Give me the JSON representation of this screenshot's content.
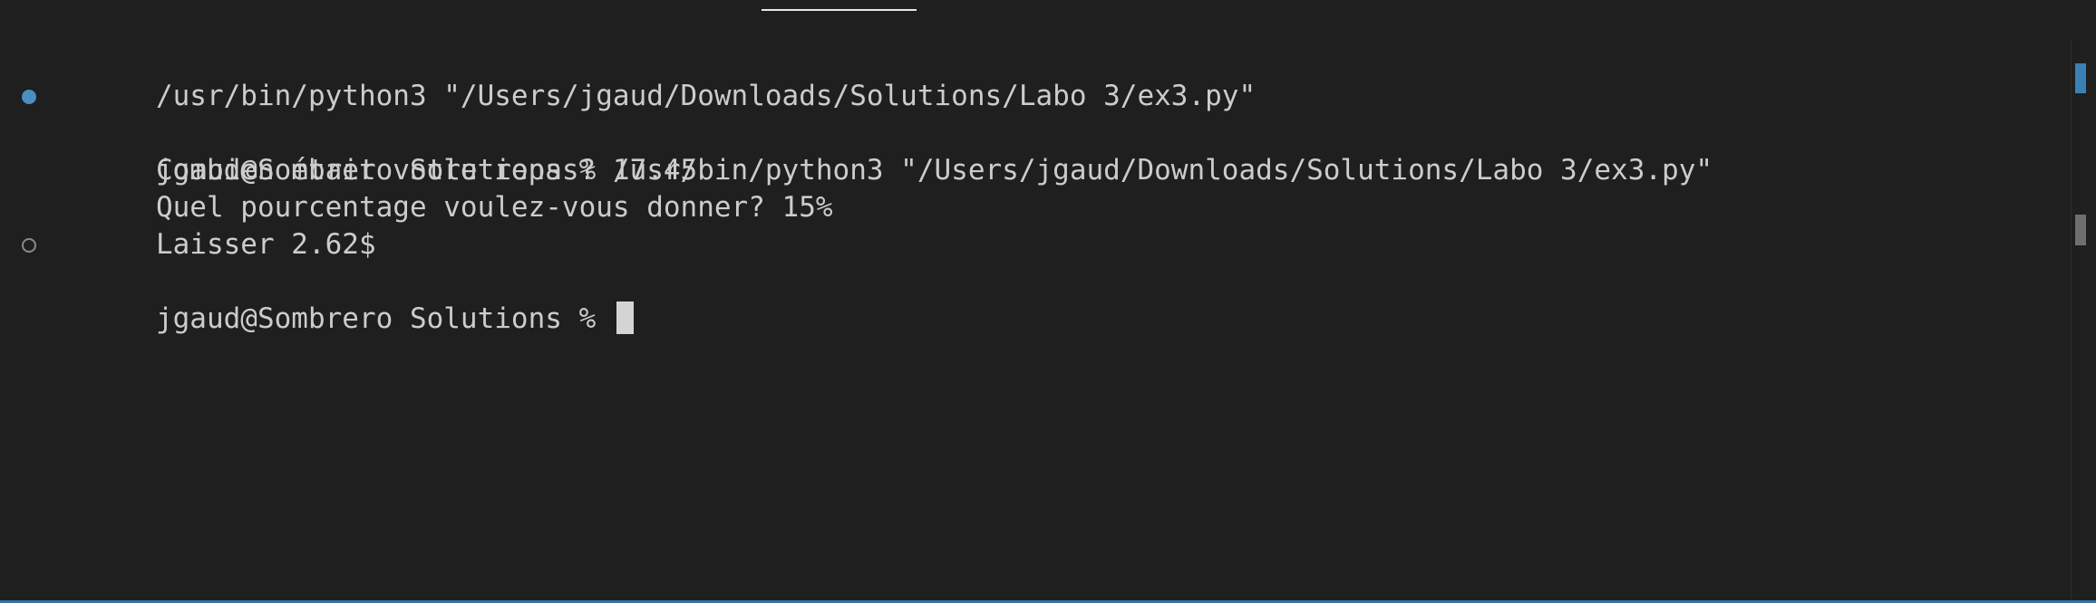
{
  "terminal": {
    "lines": [
      {
        "text": "/usr/bin/python3 \"/Users/jgaud/Downloads/Solutions/Labo 3/ex3.py\"",
        "decoration": "none"
      },
      {
        "text": "jgaud@Sombrero Solutions % /usr/bin/python3 \"/Users/jgaud/Downloads/Solutions/Labo 3/ex3.py\"",
        "decoration": "success"
      },
      {
        "text": "Combien était votre repas? 17.45",
        "decoration": "none"
      },
      {
        "text": "Quel pourcentage voulez-vous donner? 15%",
        "decoration": "none"
      },
      {
        "text": "Laisser 2.62$",
        "decoration": "none"
      },
      {
        "text": "jgaud@Sombrero Solutions % ",
        "decoration": "idle"
      }
    ]
  },
  "colors": {
    "background": "#1f1f1f",
    "text": "#cccccc",
    "success_decoration": "#4a8fbf",
    "idle_decoration": "#8a8a8a",
    "cursor": "#d4d4d4",
    "scroll_marker": "#3b80b5"
  },
  "icons": {
    "success_decoration": "command-success-circle-icon",
    "idle_decoration": "command-pending-circle-icon"
  }
}
